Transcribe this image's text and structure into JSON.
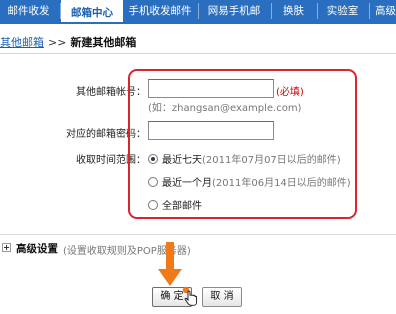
{
  "tabs": [
    {
      "label": "邮件收发",
      "active": false
    },
    {
      "label": "邮箱中心",
      "active": true
    },
    {
      "label": "手机收发邮件",
      "active": false
    },
    {
      "label": "网易手机邮",
      "active": false
    },
    {
      "label": "换肤",
      "active": false
    },
    {
      "label": "实验室",
      "active": false
    },
    {
      "label": "高级",
      "active": false
    }
  ],
  "breadcrumb": {
    "parent": "其他邮箱",
    "separator": ">>",
    "current": "新建其他邮箱"
  },
  "form": {
    "account_label": "其他邮箱帐号：",
    "account_value": "",
    "required_text": "(必填)",
    "account_hint": "(如：zhangsan@example.com)",
    "password_label": "对应的邮箱密码：",
    "password_value": "",
    "range_label": "收取时间范围：",
    "range_options": [
      {
        "label": "最近七天",
        "note": "(2011年07月07日以后的邮件)",
        "checked": true
      },
      {
        "label": "最近一个月",
        "note": "(2011年06月14日以后的邮件)",
        "checked": false
      },
      {
        "label": "全部邮件",
        "note": "",
        "checked": false
      }
    ]
  },
  "advanced": {
    "title": "高级设置",
    "description": "(设置收取规则及POP服务器)"
  },
  "buttons": {
    "confirm": "确 定",
    "cancel": "取 消"
  },
  "colors": {
    "tab_bar": "#2a6fbf",
    "annotation_frame": "#d8262e",
    "annotation_arrow": "#f07a1a"
  }
}
